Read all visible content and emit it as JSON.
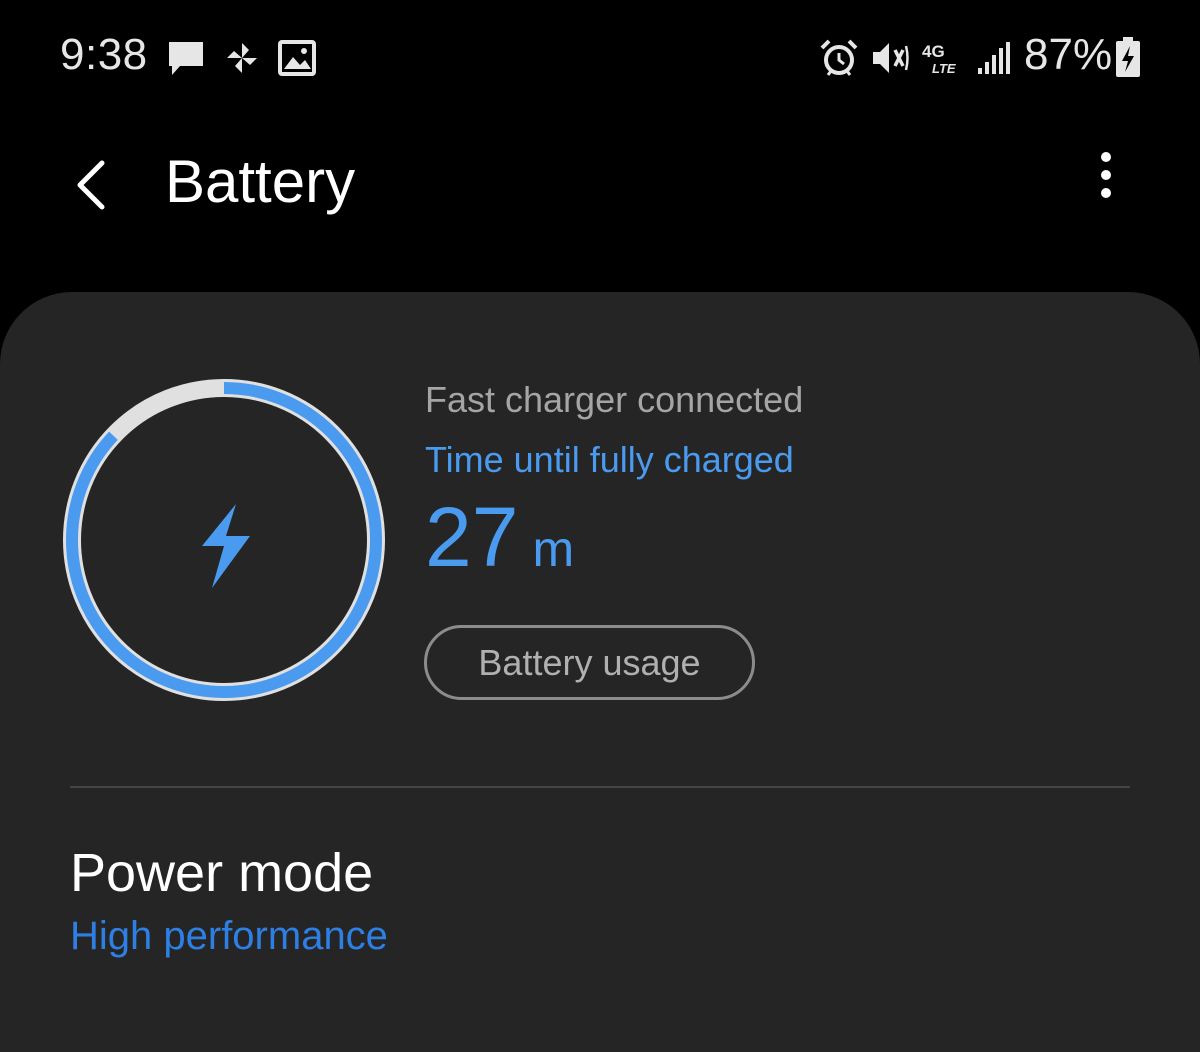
{
  "status_bar": {
    "time": "9:38",
    "battery_percent": "87%",
    "network_type": "4G LTE",
    "left_icons": [
      "message-icon",
      "pinwheel-icon",
      "gallery-icon"
    ],
    "right_icons": [
      "alarm-icon",
      "vibrate-mute-icon",
      "lte-icon",
      "signal-icon",
      "battery-charging-icon"
    ]
  },
  "header": {
    "title": "Battery",
    "back_icon": "back-chevron-icon",
    "menu_icon": "more-vertical-icon"
  },
  "battery": {
    "charge_level": 0.87,
    "charger_status": "Fast charger connected",
    "time_label": "Time until fully charged",
    "time_value": "27",
    "time_unit": "m",
    "usage_button_label": "Battery usage",
    "center_icon": "lightning-bolt-icon"
  },
  "power_mode": {
    "title": "Power mode",
    "value": "High performance"
  },
  "colors": {
    "accent": "#4a9bf0",
    "power_mode_value": "#2e7fe3",
    "card_background": "#252525",
    "page_background": "#000000",
    "ring_track": "#e0e0e0"
  }
}
